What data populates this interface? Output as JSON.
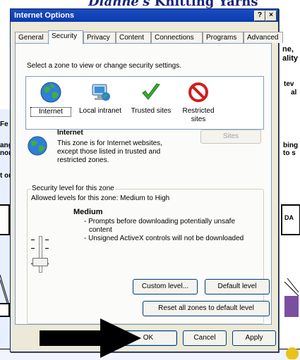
{
  "background_page": {
    "title_italic": "Dianne's",
    "title_rest": "Knitting Yarns",
    "snippets": [
      "ne,",
      "ality",
      "tev",
      "al",
      "Fe",
      "ang",
      "nor",
      "t or",
      "bing",
      "to s",
      "DA"
    ]
  },
  "dialog": {
    "title": "Internet Options",
    "help_label": "?",
    "close_label": "×",
    "tabs": [
      "General",
      "Security",
      "Privacy",
      "Content",
      "Connections",
      "Programs",
      "Advanced"
    ],
    "active_tab": "Security",
    "instruction": "Select a zone to view or change security settings.",
    "zones": [
      {
        "label": "Internet",
        "icon": "globe-icon",
        "selected": true
      },
      {
        "label": "Local intranet",
        "icon": "intranet-monitor-icon",
        "selected": false
      },
      {
        "label": "Trusted sites",
        "icon": "checkmark-icon",
        "selected": false
      },
      {
        "label": "Restricted\nsites",
        "icon": "restricted-icon",
        "selected": false
      }
    ],
    "zone_info": {
      "title": "Internet",
      "description_lines": [
        "This zone is for Internet websites,",
        "except those listed in trusted and",
        "restricted zones."
      ],
      "sites_button": "Sites"
    },
    "security_level": {
      "legend": "Security level for this zone",
      "allowed": "Allowed levels for this zone: Medium to High",
      "level_name": "Medium",
      "bullets": [
        "- Prompts before downloading potentially unsafe",
        "content",
        "- Unsigned ActiveX controls will not be downloaded"
      ],
      "custom_level_button": "Custom level...",
      "default_level_button": "Default level"
    },
    "reset_button": "Reset all zones to default level",
    "footer_buttons": {
      "ok": "OK",
      "cancel": "Cancel",
      "apply": "Apply"
    }
  },
  "colors": {
    "title_bar": "#0a3bb0",
    "dialog_bg": "#ece9d8",
    "panel_bg": "#fbfbf9"
  }
}
